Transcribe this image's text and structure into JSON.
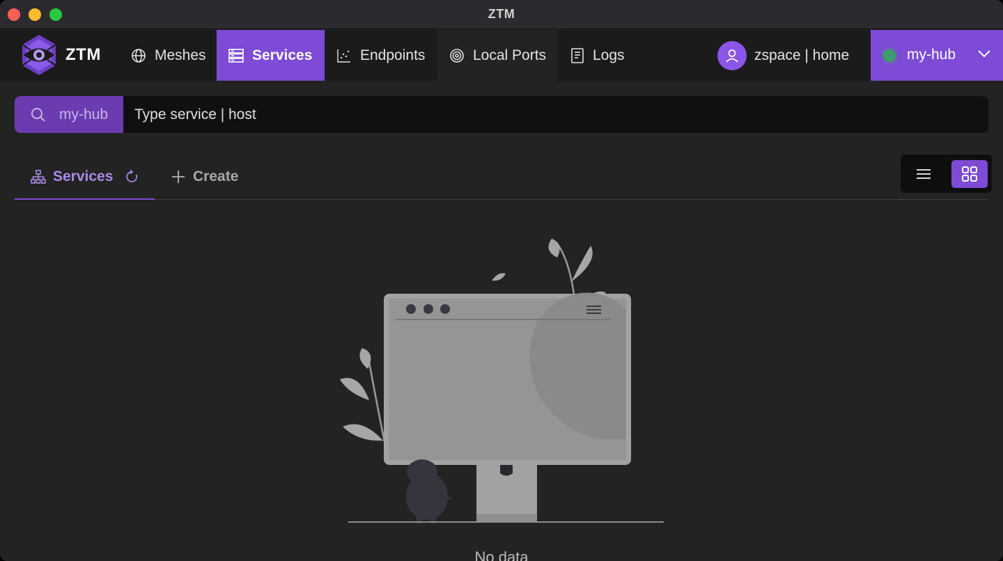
{
  "window": {
    "title": "ZTM"
  },
  "brand": {
    "name": "ZTM"
  },
  "nav": {
    "items": [
      {
        "id": "meshes",
        "label": "Meshes",
        "icon": "globe-icon"
      },
      {
        "id": "services",
        "label": "Services",
        "icon": "server-icon",
        "active": true
      },
      {
        "id": "endpoints",
        "label": "Endpoints",
        "icon": "scatter-chart-icon"
      },
      {
        "id": "localports",
        "label": "Local Ports",
        "icon": "target-icon"
      },
      {
        "id": "logs",
        "label": "Logs",
        "icon": "document-icon"
      }
    ],
    "user": {
      "label": "zspace | home",
      "icon": "user-icon"
    },
    "hub": {
      "label": "my-hub",
      "status_color": "#3f9c6d"
    }
  },
  "search": {
    "scope": "my-hub",
    "placeholder": "Type service | host",
    "value": ""
  },
  "tabs": {
    "services_label": "Services",
    "create_label": "Create"
  },
  "view_toggle": {
    "active": "grid"
  },
  "empty": {
    "message": "No data"
  },
  "colors": {
    "accent": "#7d4bd6",
    "background": "#232323",
    "navbar": "#1b1b1b"
  }
}
